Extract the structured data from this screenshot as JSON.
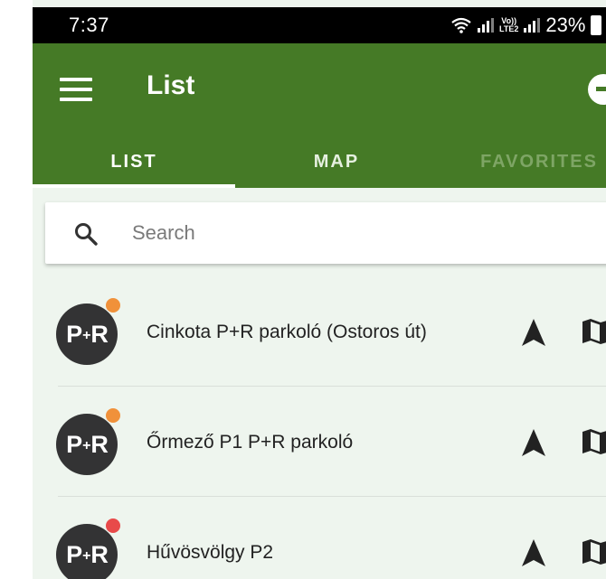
{
  "status_bar": {
    "time": "7:37",
    "battery": "23%",
    "network_badge_line1": "Vo))",
    "network_badge_line2": "LTE2"
  },
  "app_bar": {
    "title": "List"
  },
  "tabs": [
    {
      "label": "LIST",
      "selected": true
    },
    {
      "label": "MAP",
      "selected": false
    },
    {
      "label": "FAVORITES",
      "selected": false
    }
  ],
  "search": {
    "placeholder": "Search",
    "value": ""
  },
  "parkings": [
    {
      "logo_text_left": "P",
      "logo_text_plus": "+",
      "logo_text_right": "R",
      "name": "Cinkota P+R parkoló (Ostoros út)",
      "status_color": "#f0913a"
    },
    {
      "logo_text_left": "P",
      "logo_text_plus": "+",
      "logo_text_right": "R",
      "name": "Őrmező P1 P+R parkoló",
      "status_color": "#f0913a"
    },
    {
      "logo_text_left": "P",
      "logo_text_plus": "+",
      "logo_text_right": "R",
      "name": "Hűvösvölgy P2",
      "status_color": "#e84a4a"
    }
  ],
  "colors": {
    "app_bar": "#457a26",
    "list_background": "#eef5ee",
    "status_busy": "#f0913a",
    "status_full": "#e84a4a"
  },
  "icons": {
    "menu": "hamburger-menu-icon",
    "account": "account-circle-icon",
    "search": "search-icon",
    "navigate": "navigation-arrow-icon",
    "map": "map-icon"
  }
}
